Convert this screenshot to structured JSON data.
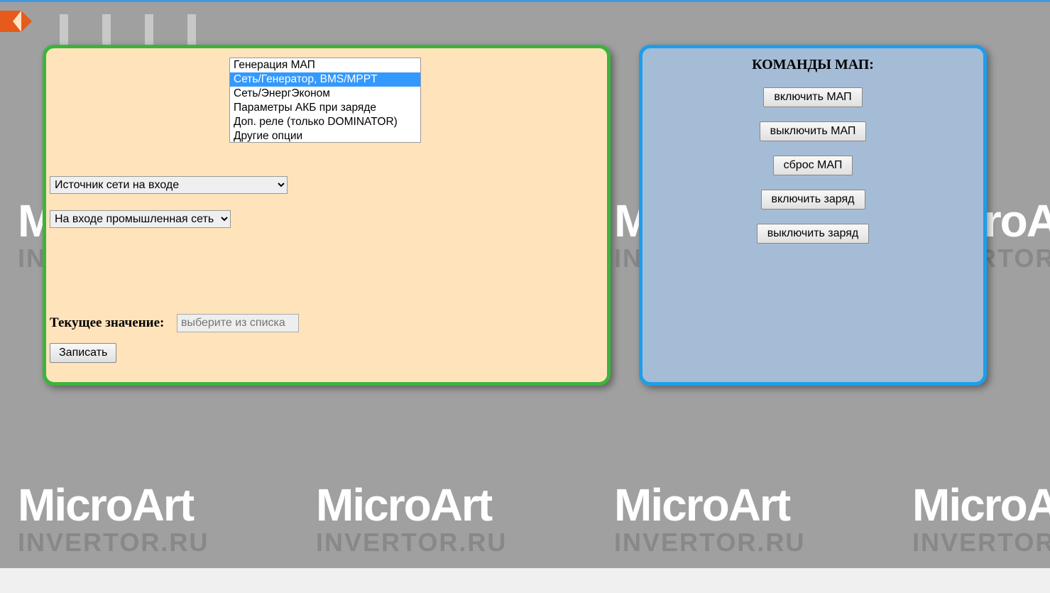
{
  "background": {
    "logo_main": "MicroArt",
    "logo_sub": "INVERTOR.RU"
  },
  "left_panel": {
    "listbox": {
      "items": [
        "Генерация МАП",
        "Сеть/Генератор, BMS/MPPT",
        "Сеть/ЭнергЭконом",
        "Параметры АКБ при заряде",
        "Доп. реле (только DOMINATOR)",
        "Другие опции"
      ],
      "selected_index": 1
    },
    "select1": {
      "value": "Источник сети на входе"
    },
    "select2": {
      "value": "На входе промышленная сеть"
    },
    "current_value_label": "Текущее значение:",
    "current_value_placeholder": "выберите из списка",
    "save_button": "Записать"
  },
  "right_panel": {
    "title": "КОМАНДЫ МАП:",
    "buttons": [
      "включить МАП",
      "выключить МАП",
      "сброс МАП",
      "включить заряд",
      "выключить заряд"
    ]
  }
}
